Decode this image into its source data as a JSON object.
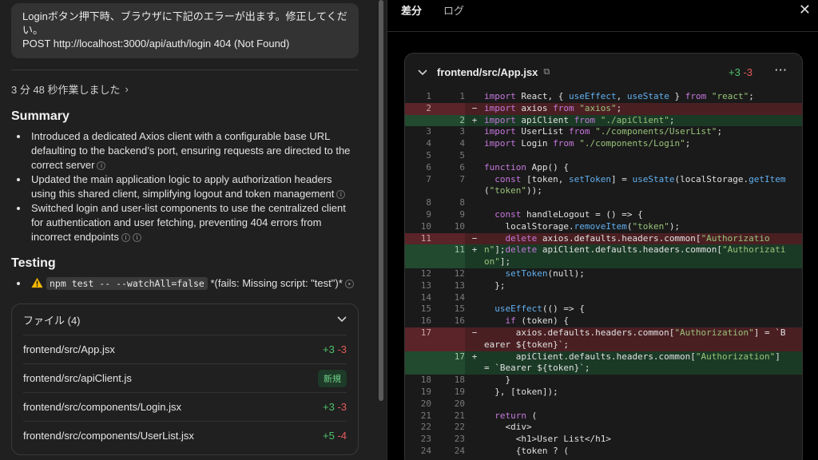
{
  "bubble": {
    "line1": "Loginボタン押下時、ブラウザに下記のエラーが出ます。修正してくださ",
    "line2": "い。",
    "line3": "POST http://localhost:3000/api/auth/login 404 (Not Found)"
  },
  "worked": "3 分 48 秒作業しました",
  "summary": {
    "title": "Summary",
    "items": [
      "Introduced a dedicated Axios client with a configurable base URL defaulting to the backend’s port, ensuring requests are directed to the correct server",
      "Updated the main application logic to apply authorization headers using this shared client, simplifying logout and token management",
      "Switched login and user-list components to use the centralized client for authentication and user fetching, preventing 404 errors from incorrect endpoints"
    ]
  },
  "testing": {
    "title": "Testing",
    "command": "npm test -- --watchAll=false",
    "result": " *(fails: Missing script: \"test\")*"
  },
  "files": {
    "header": "ファイル (4)",
    "rows": [
      {
        "name": "frontend/src/App.jsx",
        "plus": "+3",
        "minus": "-3"
      },
      {
        "name": "frontend/src/apiClient.js",
        "badge": "新規"
      },
      {
        "name": "frontend/src/components/Login.jsx",
        "plus": "+3",
        "minus": "-3"
      },
      {
        "name": "frontend/src/components/UserList.jsx",
        "plus": "+5",
        "minus": "-4"
      }
    ]
  },
  "tabs": {
    "diff": "差分",
    "log": "ログ"
  },
  "close": "✕",
  "diff": {
    "file": "frontend/src/App.jsx",
    "plus": "+3",
    "minus": "-3",
    "more": "···",
    "lines": [
      {
        "a": "1",
        "b": "1",
        "t": "ctx",
        "code": "import React, { useEffect, useState } from \"react\";"
      },
      {
        "a": "2",
        "b": "",
        "t": "del",
        "code": "import axios from \"axios\";"
      },
      {
        "a": "",
        "b": "2",
        "t": "add",
        "code": "import apiClient from \"./apiClient\";"
      },
      {
        "a": "3",
        "b": "3",
        "t": "ctx",
        "code": "import UserList from \"./components/UserList\";"
      },
      {
        "a": "4",
        "b": "4",
        "t": "ctx",
        "code": "import Login from \"./components/Login\";"
      },
      {
        "a": "5",
        "b": "5",
        "t": "ctx",
        "code": ""
      },
      {
        "a": "6",
        "b": "6",
        "t": "ctx",
        "code": "function App() {"
      },
      {
        "a": "7",
        "b": "7",
        "t": "ctx",
        "wrap": true,
        "code": "  const [token, setToken] = useState(localStorage.getItem(\"token\"));"
      },
      {
        "a": "8",
        "b": "8",
        "t": "ctx",
        "code": ""
      },
      {
        "a": "9",
        "b": "9",
        "t": "ctx",
        "code": "  const handleLogout = () => {"
      },
      {
        "a": "10",
        "b": "10",
        "t": "ctx",
        "code": "    localStorage.removeItem(\"token\");"
      },
      {
        "a": "11",
        "b": "",
        "t": "del",
        "code": "    delete axios.defaults.headers.common[\"Authorization\"];"
      },
      {
        "a": "",
        "b": "11",
        "t": "add",
        "wrap": true,
        "code": "    delete apiClient.defaults.headers.common[\"Authorization\"];"
      },
      {
        "a": "12",
        "b": "12",
        "t": "ctx",
        "code": "    setToken(null);"
      },
      {
        "a": "13",
        "b": "13",
        "t": "ctx",
        "code": "  };"
      },
      {
        "a": "14",
        "b": "14",
        "t": "ctx",
        "code": ""
      },
      {
        "a": "15",
        "b": "15",
        "t": "ctx",
        "code": "  useEffect(() => {"
      },
      {
        "a": "16",
        "b": "16",
        "t": "ctx",
        "code": "    if (token) {"
      },
      {
        "a": "17",
        "b": "",
        "t": "del",
        "wrap": true,
        "code": "      axios.defaults.headers.common[\"Authorization\"] = `Bearer ${token}`;"
      },
      {
        "a": "",
        "b": "17",
        "t": "add",
        "wrap": true,
        "code": "      apiClient.defaults.headers.common[\"Authorization\"] = `Bearer ${token}`;"
      },
      {
        "a": "18",
        "b": "18",
        "t": "ctx",
        "code": "    }"
      },
      {
        "a": "19",
        "b": "19",
        "t": "ctx",
        "code": "  }, [token]);"
      },
      {
        "a": "20",
        "b": "20",
        "t": "ctx",
        "code": ""
      },
      {
        "a": "21",
        "b": "21",
        "t": "ctx",
        "code": "  return ("
      },
      {
        "a": "22",
        "b": "22",
        "t": "ctx",
        "code": "    <div>"
      },
      {
        "a": "23",
        "b": "23",
        "t": "ctx",
        "code": "      <h1>User List</h1>"
      },
      {
        "a": "24",
        "b": "24",
        "t": "ctx",
        "code": "      {token ? ("
      }
    ]
  }
}
